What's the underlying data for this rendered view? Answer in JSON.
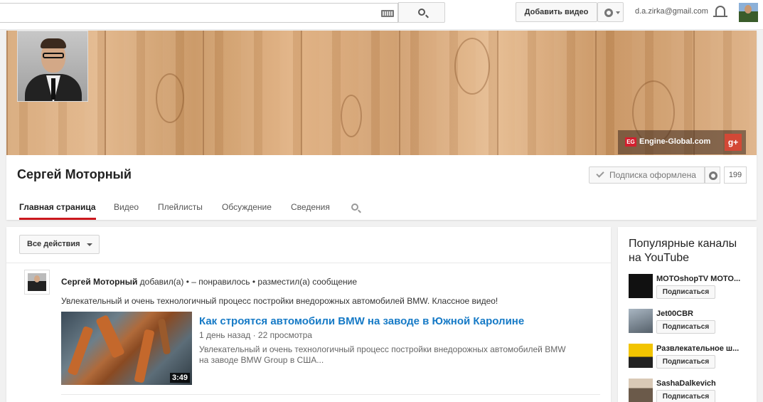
{
  "topbar": {
    "search_placeholder": "",
    "upload_label": "Добавить видео",
    "email": "d.a.zirka@gmail.com"
  },
  "channel": {
    "name": "Сергей Моторный",
    "link_text": "Engine-Global.com",
    "link_logo": "EG",
    "gplus_label": "g+",
    "subscribe_label": "Подписка оформлена",
    "subscriber_count": "199",
    "tabs": [
      {
        "label": "Главная страница",
        "active": true
      },
      {
        "label": "Видео"
      },
      {
        "label": "Плейлисты"
      },
      {
        "label": "Обсуждение"
      },
      {
        "label": "Сведения"
      }
    ]
  },
  "feed": {
    "actions_label": "Все действия",
    "post": {
      "author": "Сергей Моторный",
      "activity": " добавил(а) • – понравилось • разместил(а) сообщение",
      "text": "Увлекательный и очень технологичный процесс постройки внедорожных автомобилей BMW. Классное видео!",
      "video_title": "Как строятся автомобили BMW на заводе в Южной Каролине",
      "video_age": "1 день назад",
      "video_views": "22 просмотра",
      "video_desc": "Увлекательный и очень технологичный процесс постройки внедорожных автомобилей BMW на заводе BMW Group в США...",
      "duration": "3:49"
    }
  },
  "sidebar": {
    "title": "Популярные каналы на YouTube",
    "channels": [
      {
        "name": "MOTOshopTV MOTO...",
        "subscribe": "Подписаться",
        "color": "#111111"
      },
      {
        "name": "Jet00CBR",
        "subscribe": "Подписаться",
        "color": "#7a8a99"
      },
      {
        "name": "Развлекательное ш...",
        "subscribe": "Подписаться",
        "color": "#e5b400"
      },
      {
        "name": "SashaDalkevich",
        "subscribe": "Подписаться",
        "color": "#6b5a4a"
      }
    ]
  },
  "colors": {
    "accent_red": "#cc181e",
    "link_blue": "#167ac6"
  }
}
